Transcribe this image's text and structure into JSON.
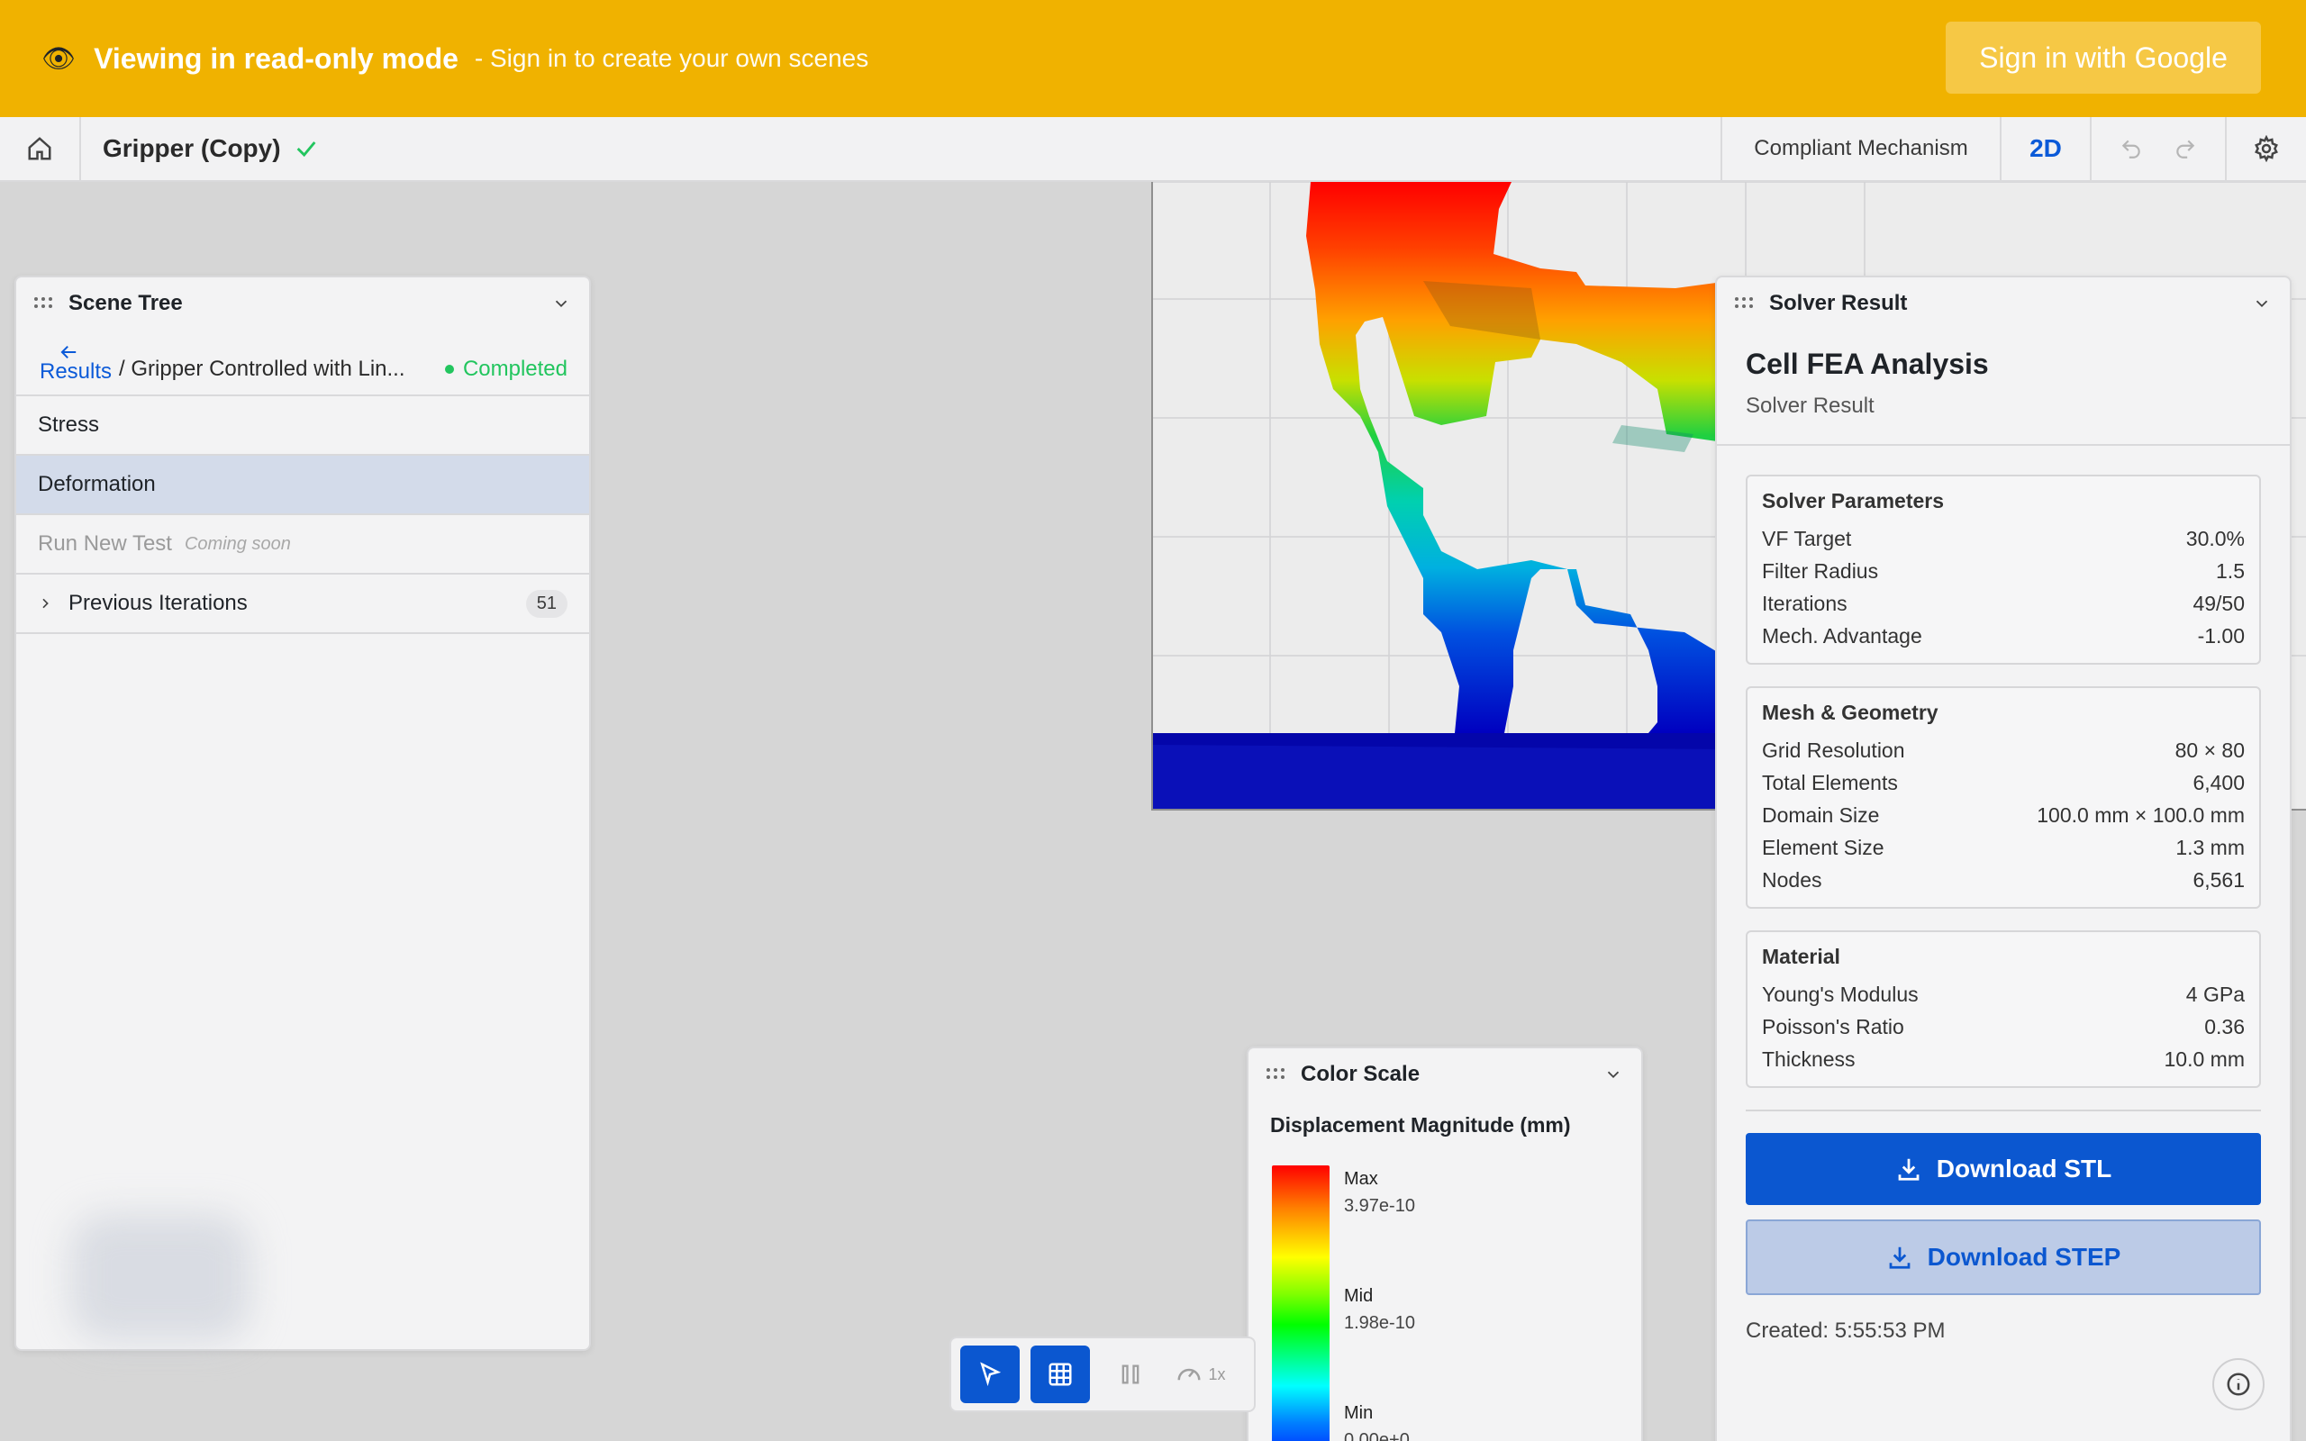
{
  "banner": {
    "eye_icon": "👁",
    "title": "Viewing in read-only mode",
    "subtitle": "- Sign in to create your own scenes",
    "signin_label": "Sign in with Google",
    "color": "#f0b200"
  },
  "topbar": {
    "project_title": "Gripper (Copy)",
    "mechanism_label": "Compliant Mechanism",
    "view_mode": "2D"
  },
  "scene_tree": {
    "title": "Scene Tree",
    "back_label": "Results",
    "path": "/ Gripper Controlled with Lin...",
    "status": "Completed",
    "items": [
      {
        "label": "Stress"
      },
      {
        "label": "Deformation"
      }
    ],
    "run_new_test": "Run New Test",
    "coming_soon": "Coming soon",
    "previous_iterations": "Previous Iterations",
    "previous_count": "51"
  },
  "solver": {
    "panel_title": "Solver Result",
    "heading": "Cell FEA Analysis",
    "subheading": "Solver Result",
    "params": {
      "title": "Solver Parameters",
      "rows": [
        {
          "k": "VF Target",
          "v": "30.0%"
        },
        {
          "k": "Filter Radius",
          "v": "1.5"
        },
        {
          "k": "Iterations",
          "v": "49/50"
        },
        {
          "k": "Mech. Advantage",
          "v": "-1.00"
        }
      ]
    },
    "mesh": {
      "title": "Mesh & Geometry",
      "rows": [
        {
          "k": "Grid Resolution",
          "v": "80 × 80"
        },
        {
          "k": "Total Elements",
          "v": "6,400"
        },
        {
          "k": "Domain Size",
          "v": "100.0 mm × 100.0 mm"
        },
        {
          "k": "Element Size",
          "v": "1.3 mm"
        },
        {
          "k": "Nodes",
          "v": "6,561"
        }
      ]
    },
    "material": {
      "title": "Material",
      "rows": [
        {
          "k": "Young's Modulus",
          "v": "4 GPa"
        },
        {
          "k": "Poisson's Ratio",
          "v": "0.36"
        },
        {
          "k": "Thickness",
          "v": "10.0 mm"
        }
      ]
    },
    "download_stl": "Download STL",
    "download_step": "Download STEP",
    "created": "Created: 5:55:53 PM"
  },
  "color_scale": {
    "title": "Color Scale",
    "label": "Displacement Magnitude (mm)",
    "max_label": "Max",
    "max_value": "3.97e-10",
    "mid_label": "Mid",
    "mid_value": "1.98e-10",
    "min_label": "Min",
    "min_value": "0.00e+0"
  },
  "toolbar": {
    "speed_label": "1x"
  }
}
